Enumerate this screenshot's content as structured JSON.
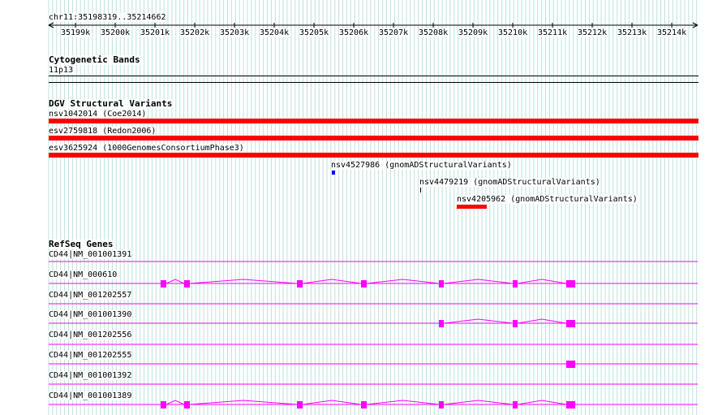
{
  "ruler": {
    "location": "chr11:35198319..35214662",
    "ticks": [
      "35199k",
      "35200k",
      "35201k",
      "35202k",
      "35203k",
      "35204k",
      "35205k",
      "35206k",
      "35207k",
      "35208k",
      "35209k",
      "35210k",
      "35211k",
      "35212k",
      "35213k",
      "35214k"
    ]
  },
  "cytoband": {
    "title": "Cytogenetic Bands",
    "band": "11p13"
  },
  "dgv": {
    "title": "DGV Structural Variants",
    "variants": [
      {
        "label": "nsv1042014 (Coe2014)",
        "color": "#ff0000"
      },
      {
        "label": "esv2759818 (Redon2006)",
        "color": "#ff0000"
      },
      {
        "label": "esv3625924 (1000GenomesConsortiumPhase3)",
        "color": "#ff0000"
      },
      {
        "label": "nsv4527986 (gnomADStructuralVariants)",
        "color": "#0000ff"
      },
      {
        "label": "nsv4479219 (gnomADStructuralVariants)",
        "color": "#000000"
      },
      {
        "label": "nsv4205962 (gnomADStructuralVariants)",
        "color": "#ff0000"
      }
    ]
  },
  "refseq": {
    "title": "RefSeq Genes",
    "color": "#ff00ff",
    "genes": [
      {
        "label": "CD44|NM_001001391"
      },
      {
        "label": "CD44|NM_000610"
      },
      {
        "label": "CD44|NM_001202557"
      },
      {
        "label": "CD44|NM_001001390"
      },
      {
        "label": "CD44|NM_001202556"
      },
      {
        "label": "CD44|NM_001202555"
      },
      {
        "label": "CD44|NM_001001392"
      },
      {
        "label": "CD44|NM_001001389"
      }
    ]
  }
}
